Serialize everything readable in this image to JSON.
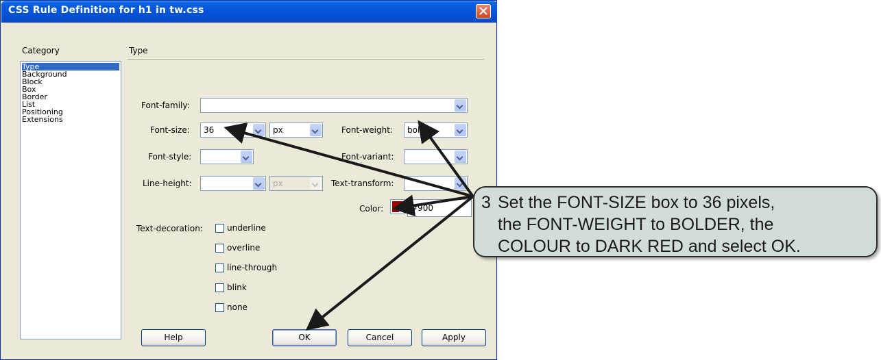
{
  "window": {
    "title": "CSS Rule Definition for h1 in tw.css",
    "close_icon": "close-icon"
  },
  "category": {
    "heading": "Category",
    "items": [
      "Type",
      "Background",
      "Block",
      "Box",
      "Border",
      "List",
      "Positioning",
      "Extensions"
    ],
    "selected": "Type"
  },
  "panel": {
    "heading": "Type"
  },
  "fields": {
    "font_family": {
      "label": "Font-family:",
      "value": ""
    },
    "font_size": {
      "label": "Font-size:",
      "value": "36",
      "unit": "px"
    },
    "font_weight": {
      "label": "Font-weight:",
      "value": "bolder"
    },
    "font_style": {
      "label": "Font-style:",
      "value": ""
    },
    "font_variant": {
      "label": "Font-variant:",
      "value": ""
    },
    "line_height": {
      "label": "Line-height:",
      "value": "",
      "unit": "px"
    },
    "text_transform": {
      "label": "Text-transform:",
      "value": ""
    },
    "color": {
      "label": "Color:",
      "value": "#900",
      "swatch": "#990000"
    },
    "text_decoration": {
      "label": "Text-decoration:",
      "options": [
        "underline",
        "overline",
        "line-through",
        "blink",
        "none"
      ]
    }
  },
  "buttons": {
    "help": "Help",
    "ok": "OK",
    "cancel": "Cancel",
    "apply": "Apply"
  },
  "callout": {
    "number": "3",
    "lines": [
      "Set the FONT-SIZE box to 36 pixels,",
      "the FONT-WEIGHT to BOLDER, the",
      "COLOUR to DARK RED and select OK."
    ]
  },
  "colors": {
    "title_bar": "#0552d6",
    "dialog_bg": "#ece9d8",
    "selection": "#316ac5",
    "callout_bg": "#d2ddd8"
  }
}
